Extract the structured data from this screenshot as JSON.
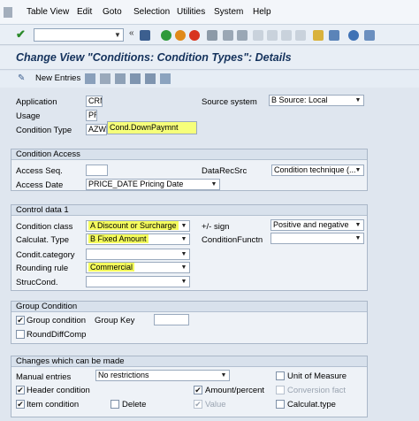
{
  "menu": [
    "Table View",
    "Edit",
    "Goto",
    "Selection",
    "Utilities",
    "System",
    "Help"
  ],
  "menu_underline": [
    "T",
    "E",
    "G",
    "S",
    "U",
    "y",
    "H"
  ],
  "title": "Change View \"Conditions: Condition Types\": Details",
  "app_toolbar": {
    "new_entries": "New Entries"
  },
  "header": {
    "application_label": "Application",
    "application_value": "CRM",
    "usage_label": "Usage",
    "usage_value": "PR",
    "condition_type_label": "Condition Type",
    "condition_type_code": "AZWA",
    "condition_type_desc": "Cond.DownPaymnt",
    "source_system_label": "Source system",
    "source_system_value": "B Source: Local"
  },
  "condition_access": {
    "title": "Condition Access",
    "access_seq_label": "Access Seq.",
    "access_seq_value": "",
    "access_date_label": "Access Date",
    "access_date_value": "PRICE_DATE Pricing Date",
    "datarecsrc_label": "DataRecSrc",
    "datarecsrc_value": "Condition technique (..."
  },
  "control_data": {
    "title": "Control data 1",
    "condition_class_label": "Condition class",
    "condition_class_value": "A Discount or Surcharge",
    "calc_type_label": "Calculat. Type",
    "calc_type_value": "B Fixed Amount",
    "cond_category_label": "Condit.category",
    "cond_category_value": "",
    "rounding_rule_label": "Rounding rule",
    "rounding_rule_value": "Commercial",
    "struc_cond_label": "StrucCond.",
    "struc_cond_value": "",
    "sign_label": "+/- sign",
    "sign_value": "Positive and negative",
    "cond_function_label": "ConditionFunctn",
    "cond_function_value": ""
  },
  "group_condition": {
    "title": "Group Condition",
    "group_condition_label": "Group condition",
    "group_condition_checked": true,
    "group_key_label": "Group Key",
    "group_key_value": "",
    "round_diff_label": "RoundDiffComp",
    "round_diff_checked": false
  },
  "changes": {
    "title": "Changes which can be made",
    "manual_entries_label": "Manual entries",
    "manual_entries_value": "No restrictions",
    "unit_of_measure_label": "Unit of Measure",
    "header_condition_label": "Header condition",
    "amount_percent_label": "Amount/percent",
    "conversion_fact_label": "Conversion fact",
    "delete_label": "Delete",
    "item_condition_label": "Item condition",
    "value_label": "Value",
    "calc_type_label": "Calculat.type"
  },
  "colors": {
    "highlight": "#f6ff3c",
    "title_text": "#14325c"
  }
}
